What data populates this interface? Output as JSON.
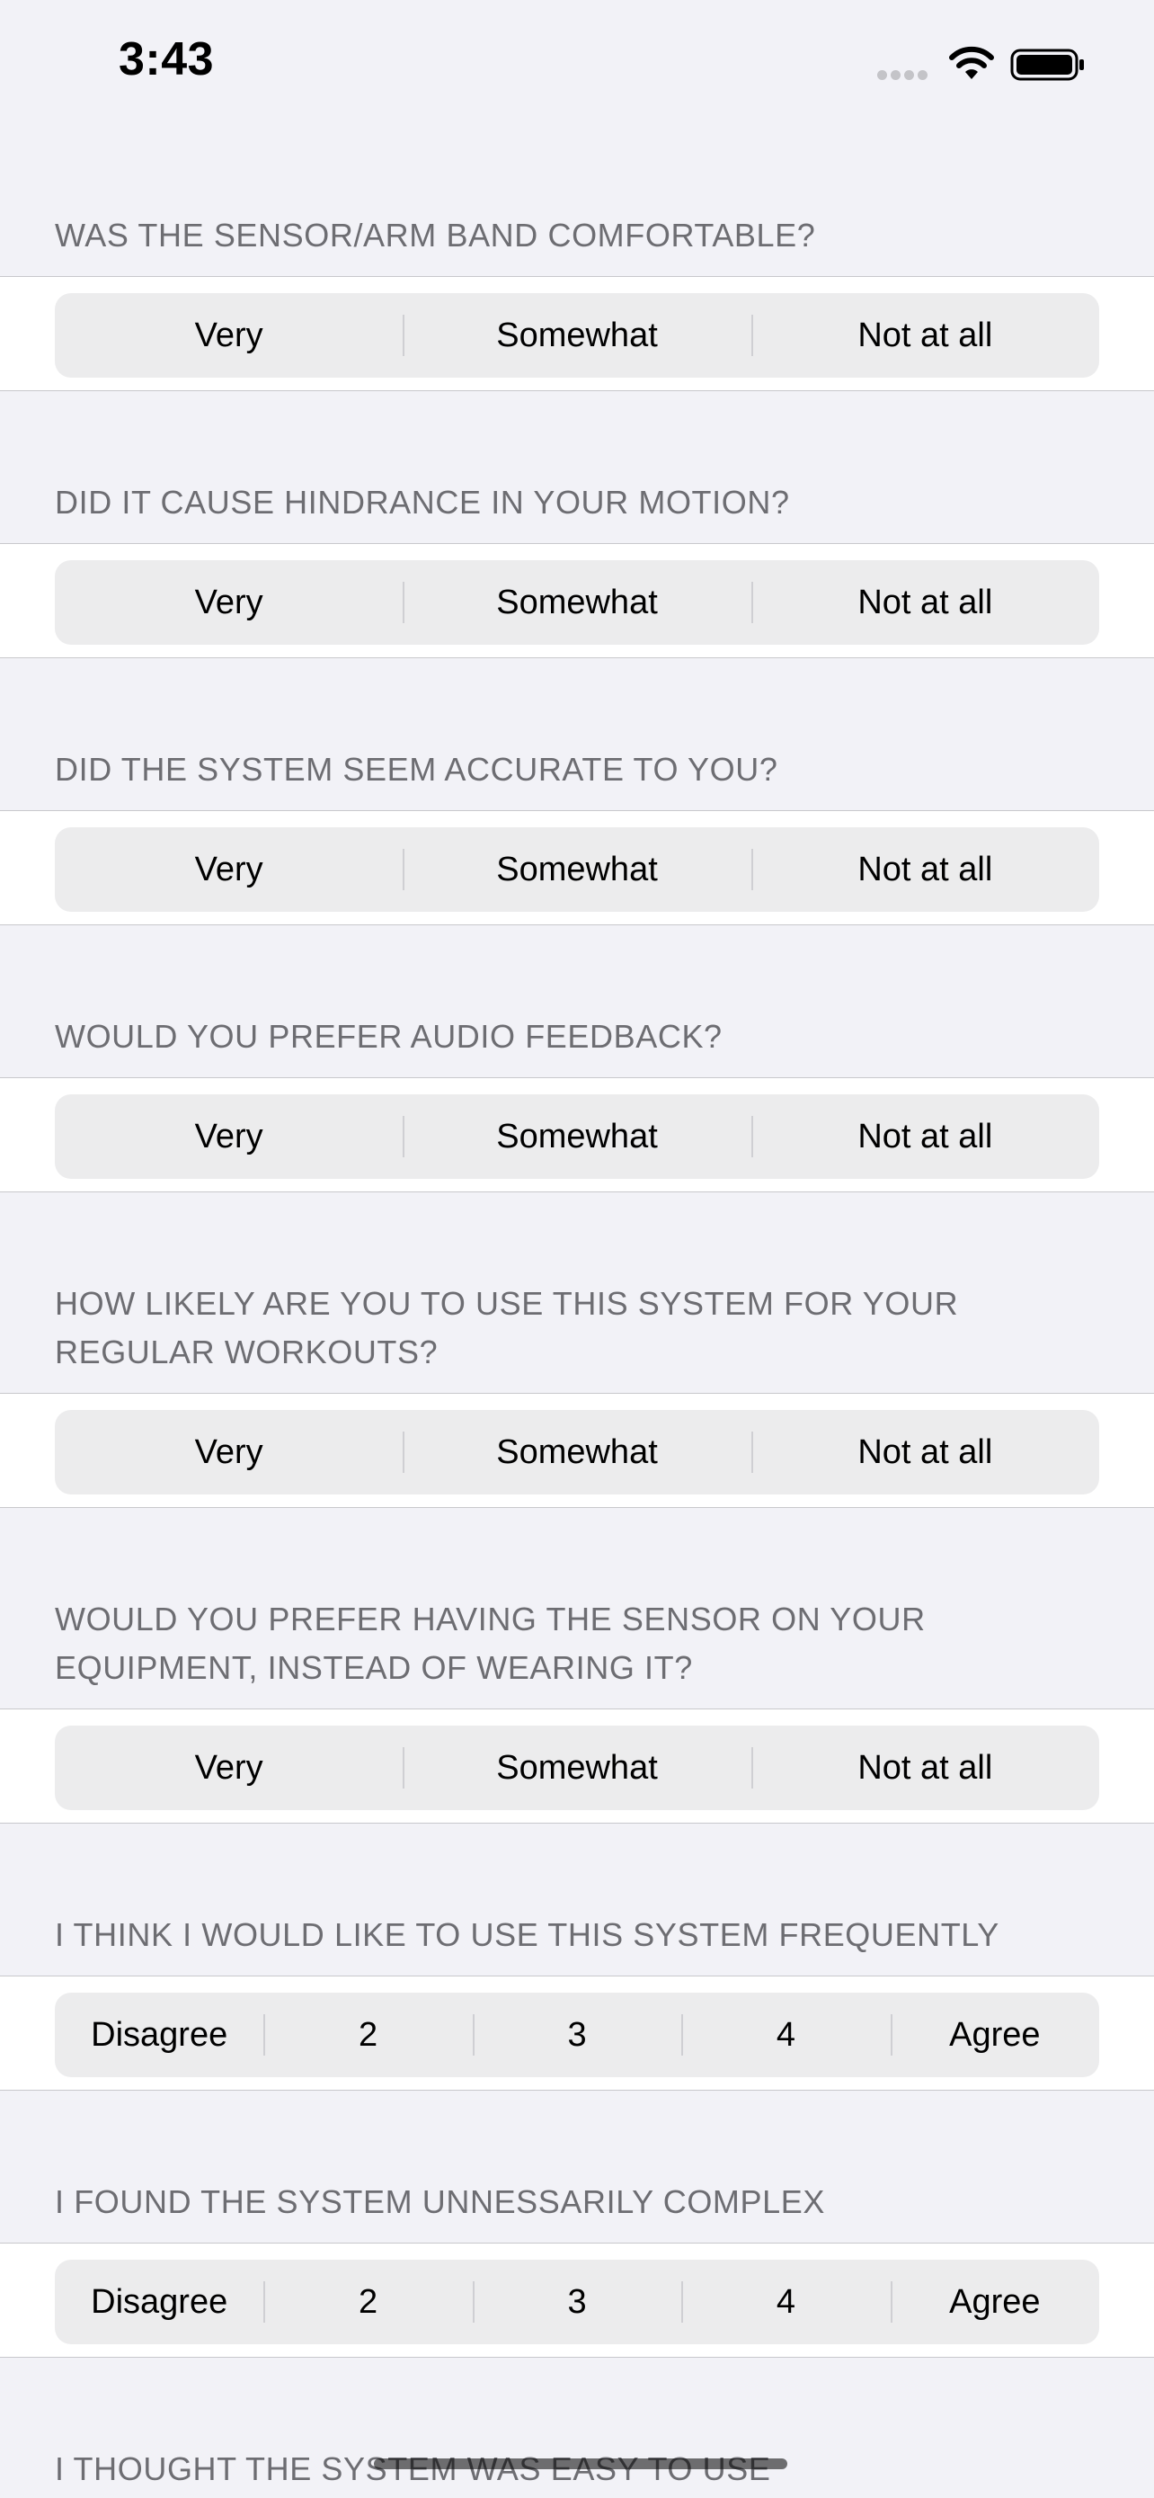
{
  "status": {
    "time": "3:43"
  },
  "questions": [
    {
      "header": "WAS THE SENSOR/ARM BAND COMFORTABLE?",
      "options": [
        "Very",
        "Somewhat",
        "Not at all"
      ]
    },
    {
      "header": "DID IT CAUSE HINDRANCE IN YOUR MOTION?",
      "options": [
        "Very",
        "Somewhat",
        "Not at all"
      ]
    },
    {
      "header": "DID THE SYSTEM SEEM ACCURATE TO YOU?",
      "options": [
        "Very",
        "Somewhat",
        "Not at all"
      ]
    },
    {
      "header": "WOULD YOU PREFER AUDIO FEEDBACK?",
      "options": [
        "Very",
        "Somewhat",
        "Not at all"
      ]
    },
    {
      "header": "HOW LIKELY ARE YOU TO USE THIS SYSTEM FOR YOUR REGULAR WORKOUTS?",
      "options": [
        "Very",
        "Somewhat",
        "Not at all"
      ]
    },
    {
      "header": "WOULD YOU PREFER HAVING THE SENSOR ON YOUR EQUIPMENT, INSTEAD OF WEARING IT?",
      "options": [
        "Very",
        "Somewhat",
        "Not at all"
      ]
    },
    {
      "header": "I THINK I WOULD LIKE TO USE THIS SYSTEM FREQUENTLY",
      "options": [
        "Disagree",
        "2",
        "3",
        "4",
        "Agree"
      ]
    },
    {
      "header": "I FOUND THE SYSTEM UNNESSARILY COMPLEX",
      "options": [
        "Disagree",
        "2",
        "3",
        "4",
        "Agree"
      ]
    },
    {
      "header": "I THOUGHT THE SYSTEM WAS EASY TO USE",
      "options": []
    }
  ]
}
